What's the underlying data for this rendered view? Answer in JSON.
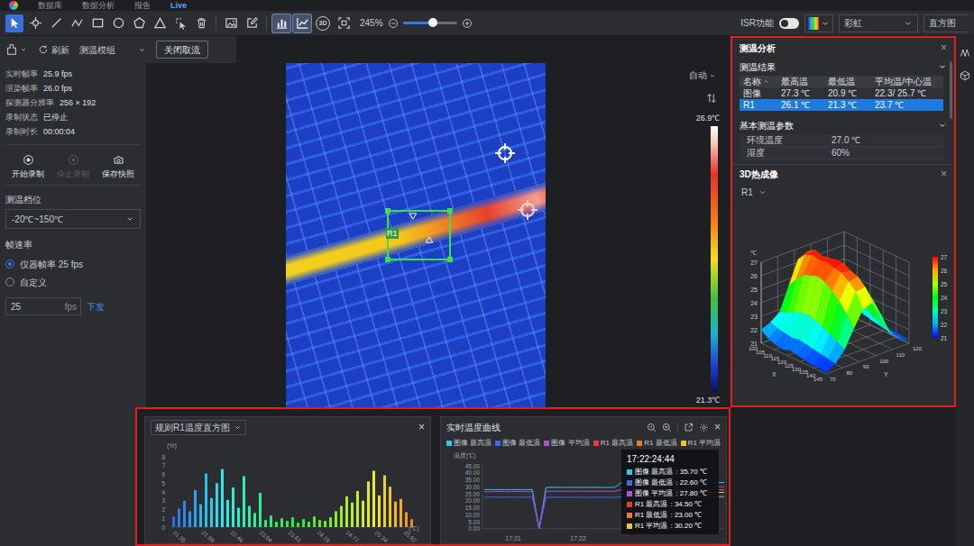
{
  "app_tabs": [
    {
      "label": "数据库",
      "selected": false
    },
    {
      "label": "数据分析",
      "selected": false
    },
    {
      "label": "报告",
      "selected": false
    },
    {
      "label": "Live",
      "selected": true
    }
  ],
  "toolbar": {
    "draw_tools": [
      {
        "kind": "pointer",
        "selected": true
      },
      {
        "kind": "point",
        "selected": false
      },
      {
        "kind": "line",
        "selected": false
      },
      {
        "kind": "polyline",
        "selected": false
      },
      {
        "kind": "rect",
        "selected": false
      },
      {
        "kind": "circle",
        "selected": false
      },
      {
        "kind": "polygon",
        "selected": false
      },
      {
        "kind": "triangle",
        "selected": false
      },
      {
        "kind": "select",
        "selected": false
      },
      {
        "kind": "trash",
        "selected": false
      }
    ],
    "edit_tools": [
      {
        "kind": "image",
        "selected": false
      },
      {
        "kind": "edit",
        "selected": false
      }
    ],
    "view_tools": [
      {
        "kind": "bar",
        "selected": true
      },
      {
        "kind": "area",
        "selected": true
      },
      {
        "kind": "3d",
        "label": "3D",
        "selected": false
      },
      {
        "kind": "fit",
        "selected": false
      }
    ],
    "zoom": {
      "reading": "245%",
      "level": 0.55
    },
    "isr": {
      "label": "ISR功能",
      "on": false
    },
    "palette": {
      "value": "彩虹"
    },
    "display": {
      "value": "直方图"
    }
  },
  "stream_bar": {
    "refresh": "刷新",
    "module": "测温模组",
    "close": "关闭取流"
  },
  "status": [
    {
      "label": "实时帧率",
      "value": "25.9 fps"
    },
    {
      "label": "渲染帧率",
      "value": "26.0 fps"
    },
    {
      "label": "探测器分辨率",
      "value": "256 × 192"
    },
    {
      "label": "录制状态",
      "value": "已停止"
    },
    {
      "label": "录制时长",
      "value": "00:00:04"
    }
  ],
  "record_buttons": [
    {
      "kind": "record",
      "label": "开始录制",
      "disabled": false
    },
    {
      "kind": "stop",
      "label": "停止录制",
      "disabled": true
    },
    {
      "kind": "snapshot",
      "label": "保存快照",
      "disabled": false
    }
  ],
  "range": {
    "label": "测温档位",
    "value": "-20℃~150℃"
  },
  "frame_rate": {
    "label": "帧速率",
    "options": [
      {
        "label": "仪器帧率 25 fps",
        "selected": true
      },
      {
        "label": "自定义",
        "selected": false
      }
    ],
    "value": "25",
    "unit": "fps",
    "submit": "下发"
  },
  "view": {
    "scale_mode": "自动",
    "scale_max": "26.9℃",
    "scale_min": "21.3℃",
    "roi_label": "R1"
  },
  "analysis": {
    "title": "测温分析",
    "close": "×",
    "results_title": "测温结果",
    "columns": [
      "名称",
      "最高温",
      "最低温",
      "平均温/中心温"
    ],
    "rows": [
      {
        "cells": [
          "图像",
          "27.3 ℃",
          "20.9 ℃",
          "22.3/ 25.7 ℃"
        ],
        "selected": false
      },
      {
        "cells": [
          "R1",
          "26.1 ℃",
          "21.3 ℃",
          "23.7 ℃"
        ],
        "selected": true
      }
    ],
    "params_title": "基本测温参数",
    "params": [
      {
        "label": "环境温度",
        "value": "27.0 ℃"
      },
      {
        "label": "湿度",
        "value": "60%"
      }
    ]
  },
  "thermal3d": {
    "title": "3D热成像",
    "close": "×",
    "roi": "R1",
    "unit": "℃",
    "z_ticks": [
      "27",
      "26",
      "25",
      "24",
      "23",
      "22",
      "21"
    ],
    "x_label": "X",
    "x_ticks": [
      "100",
      "105",
      "110",
      "115",
      "120",
      "125",
      "130",
      "135",
      "140",
      "145"
    ],
    "y_label": "Y",
    "y_ticks": [
      "70",
      "80",
      "90",
      "100",
      "110",
      "120"
    ],
    "color_ticks": [
      "27",
      "26",
      "25",
      "24",
      "23",
      "22",
      "21"
    ],
    "surface": [
      [
        22.0,
        22.3,
        22.8,
        24.5,
        26.2,
        26.5,
        25.0,
        23.0,
        22.2,
        21.8
      ],
      [
        21.6,
        22.1,
        23.0,
        25.2,
        26.8,
        26.9,
        25.4,
        23.2,
        22.0,
        21.7
      ],
      [
        21.4,
        22.0,
        23.3,
        25.8,
        27.0,
        26.7,
        25.6,
        23.4,
        22.1,
        21.6
      ],
      [
        21.3,
        21.9,
        23.5,
        26.0,
        26.9,
        26.8,
        25.8,
        23.6,
        22.3,
        21.5
      ],
      [
        21.5,
        22.0,
        23.6,
        26.2,
        27.0,
        26.9,
        25.9,
        23.5,
        22.2,
        21.6
      ],
      [
        21.4,
        21.9,
        23.4,
        26.0,
        26.8,
        26.9,
        25.7,
        23.3,
        22.0,
        21.5
      ],
      [
        21.3,
        21.8,
        23.2,
        25.6,
        26.7,
        26.6,
        25.4,
        23.1,
        21.9,
        21.4
      ],
      [
        21.2,
        21.7,
        22.9,
        25.1,
        26.3,
        26.4,
        25.0,
        22.8,
        21.8,
        21.3
      ],
      [
        21.2,
        21.6,
        22.6,
        24.4,
        25.8,
        25.9,
        24.5,
        22.5,
        21.7,
        21.3
      ],
      [
        21.1,
        21.5,
        22.3,
        23.6,
        24.8,
        25.0,
        23.8,
        22.2,
        21.6,
        21.2
      ]
    ]
  },
  "histogram": {
    "title": "规则R1温度直方图",
    "close": "×",
    "unit": "(%)",
    "y_ticks": [
      "8",
      "7",
      "6",
      "5",
      "4",
      "3",
      "2",
      "1",
      "0"
    ],
    "x_ticks": [
      "21.35",
      "21.89",
      "22.46",
      "23.04",
      "23.61",
      "24.19",
      "24.77",
      "25.34",
      "25.92"
    ],
    "x_unit": "(℃)",
    "bars": [
      1.2,
      2.1,
      3.0,
      1.8,
      4.2,
      2.6,
      6.1,
      3.3,
      5.0,
      6.6,
      3.1,
      4.5,
      2.2,
      5.8,
      2.4,
      1.6,
      3.9,
      0.8,
      1.3,
      0.6,
      1.0,
      0.7,
      1.1,
      0.5,
      0.9,
      0.6,
      1.2,
      0.8,
      0.7,
      1.1,
      1.8,
      2.4,
      3.5,
      2.8,
      4.1,
      3.0,
      5.2,
      6.4,
      3.6,
      5.9,
      4.6,
      2.9,
      3.2,
      1.7,
      0.9
    ]
  },
  "curve": {
    "title": "实时温度曲线",
    "close": "×",
    "y_title": "温度(℃)",
    "y_ticks": [
      "45.00",
      "40.00",
      "35.00",
      "30.00",
      "25.00",
      "20.00",
      "15.00",
      "10.00",
      "5.00",
      "0.00"
    ],
    "x_ticks": [
      "17:21",
      "17:22"
    ],
    "series": [
      {
        "name": "图像 最高温",
        "color": "#2ec7f0",
        "values": [
          28,
          28,
          28,
          28,
          28,
          28,
          28,
          28,
          0,
          29.5,
          29.6,
          29.5,
          29.5,
          29.6,
          29.5,
          29.5,
          29.6,
          29.5,
          29.5,
          29.6,
          33,
          33.2,
          33,
          33.1,
          35.7,
          33,
          33.2,
          33,
          33.1,
          33,
          33,
          33.2,
          33,
          33.1,
          33,
          33
        ]
      },
      {
        "name": "图像 最低温",
        "color": "#3b6cf0",
        "values": [
          22.5,
          22.6,
          22.5,
          22.5,
          22.6,
          22.5,
          22.5,
          22.6,
          0,
          22.4,
          22.5,
          22.4,
          22.5,
          22.4,
          22.5,
          22.4,
          22.5,
          22.4,
          22.5,
          22.4,
          22.6,
          22.6,
          22.7,
          22.6,
          22.6,
          22.6,
          22.7,
          22.6,
          22.6,
          22.6,
          22.7,
          22.6,
          22.6,
          22.6,
          22.7,
          22.6
        ]
      },
      {
        "name": "图像 平均温",
        "color": "#b04fd8",
        "values": [
          26.5,
          26.5,
          26.6,
          26.5,
          26.5,
          26.6,
          26.5,
          26.5,
          0,
          26.8,
          26.8,
          26.9,
          26.8,
          26.8,
          26.9,
          26.8,
          26.8,
          26.9,
          26.8,
          26.8,
          27.8,
          27.8,
          27.9,
          27.8,
          27.8,
          27.8,
          27.9,
          27.8,
          27.8,
          27.8,
          27.9,
          27.8,
          27.8,
          27.8,
          27.9,
          27.8
        ]
      },
      {
        "name": "R1 最高温",
        "color": "#f03838",
        "values": [
          null,
          null,
          null,
          null,
          null,
          null,
          null,
          null,
          null,
          null,
          null,
          null,
          null,
          null,
          null,
          null,
          null,
          null,
          null,
          null,
          null,
          null,
          null,
          null,
          34.5,
          30,
          31,
          30,
          33,
          30.5,
          30,
          30,
          30.5,
          30,
          30,
          30
        ]
      },
      {
        "name": "R1 最低温",
        "color": "#f07a2a",
        "values": [
          null,
          null,
          null,
          null,
          null,
          null,
          null,
          null,
          null,
          null,
          null,
          null,
          null,
          null,
          null,
          null,
          null,
          null,
          null,
          null,
          null,
          null,
          null,
          null,
          23,
          23.2,
          23,
          23.1,
          23,
          23,
          23.2,
          23,
          23,
          23.1,
          23,
          23
        ]
      },
      {
        "name": "R1 平均温",
        "color": "#f2c230",
        "values": [
          null,
          null,
          null,
          null,
          null,
          null,
          null,
          null,
          null,
          null,
          null,
          null,
          null,
          null,
          null,
          null,
          null,
          null,
          null,
          null,
          null,
          null,
          null,
          null,
          30.2,
          26,
          27,
          26,
          28,
          26.5,
          26,
          26,
          26.5,
          26,
          26,
          26
        ]
      }
    ],
    "tooltip": {
      "time": "17:22:24:44",
      "rows": [
        {
          "label": "图像 最高温",
          "value": ": 35.70 ℃"
        },
        {
          "label": "图像 最低温",
          "value": ": 22.60 ℃"
        },
        {
          "label": "图像 平均温",
          "value": ": 27.80 ℃"
        },
        {
          "label": "R1 最高温",
          "value": ": 34.50 ℃"
        },
        {
          "label": "R1 最低温",
          "value": ": 23.00 ℃"
        },
        {
          "label": "R1 平均温",
          "value": ": 30.20 ℃"
        }
      ]
    }
  }
}
